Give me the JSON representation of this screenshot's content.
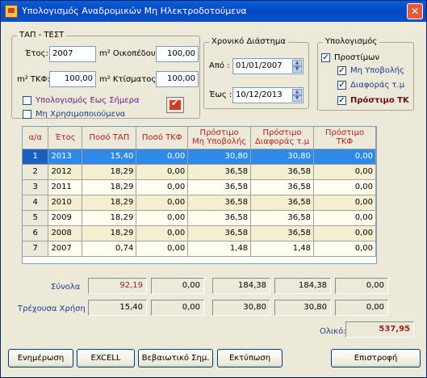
{
  "window": {
    "title": "Υπολογισμός Αναδρομικών Μη Ηλεκτροδοτούμενα",
    "close_glyph": "✕"
  },
  "tap_group": {
    "legend": "ΤΑΠ - ΤΕΣΤ",
    "etos_label": "Έτος:",
    "etos_value": "2007",
    "oikopedou_label": "m² Οικοπέδου:",
    "oikopedou_value": "100,00",
    "tkf_label": "m² ΤΚΦ:",
    "tkf_value": "100,00",
    "ktismatos_label": "m² Κτίσματος:",
    "ktismatos_value": "100,00",
    "calc_today_label": "Υπολογισμός Εως Σήμερα",
    "unused_label": "Μη Χρησιμοποιούμενα"
  },
  "time_group": {
    "legend": "Χρονικό Διάστημα",
    "from_label": "Από :",
    "from_value": "01/01/2007",
    "to_label": "Έως :",
    "to_value": "10/12/2013"
  },
  "calc_group": {
    "legend": "Υπολογισμός",
    "prostimon_label": "Προστίμων",
    "mi_ypovolis_label": "Μη Υποβολής",
    "diaforas_label": "Διαφοράς τ.μ",
    "prostimo_tk_label": "Πρόστιμο ΤΚ"
  },
  "grid": {
    "columns": [
      "α/α",
      "Έτος",
      "Ποσό ΤΑΠ",
      "Ποσό ΤΚΦ",
      "Πρόστιμο\nΜη Υποβολής",
      "Πρόστιμο\nΔιαφοράς τ.μ",
      "Πρόστιμο\nΤΚΦ"
    ],
    "rows": [
      [
        "1",
        "2013",
        "15,40",
        "0,00",
        "30,80",
        "30,80",
        "0,00"
      ],
      [
        "2",
        "2012",
        "18,29",
        "0,00",
        "36,58",
        "36,58",
        "0,00"
      ],
      [
        "3",
        "2011",
        "18,29",
        "0,00",
        "36,58",
        "36,58",
        "0,00"
      ],
      [
        "4",
        "2010",
        "18,29",
        "0,00",
        "36,58",
        "36,58",
        "0,00"
      ],
      [
        "5",
        "2009",
        "18,29",
        "0,00",
        "36,58",
        "36,58",
        "0,00"
      ],
      [
        "6",
        "2008",
        "18,29",
        "0,00",
        "36,58",
        "36,58",
        "0,00"
      ],
      [
        "7",
        "2007",
        "0,74",
        "0,00",
        "1,48",
        "1,48",
        "0,00"
      ]
    ]
  },
  "totals": {
    "synola_label": "Σύνολα",
    "synola": [
      "92,19",
      "0,00",
      "184,38",
      "184,38",
      "0,00"
    ],
    "current_label": "Τρέχουσα Χρήση",
    "current": [
      "15,40",
      "0,00",
      "30,80",
      "30,80",
      "0,00"
    ],
    "oliko_label": "Ολικό:",
    "oliko_value": "537,95"
  },
  "buttons": {
    "update": "Ενημέρωση",
    "excel": "EXCELL",
    "certificate": "Βεβαιωτικό Σημ.",
    "print": "Εκτύπωση",
    "back": "Επιστροφή"
  },
  "colors": {
    "selection": "#2e8ae6",
    "title_bar": "#0a5fd8",
    "accent_text": "#a02020"
  }
}
